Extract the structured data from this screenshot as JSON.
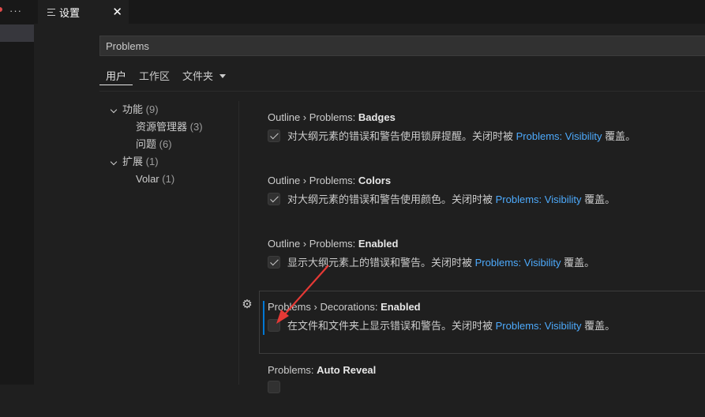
{
  "left_strip": {
    "more_label": "···"
  },
  "tab": {
    "title": "设置",
    "close": "✕"
  },
  "search": {
    "value": "Problems"
  },
  "scope_tabs": [
    {
      "label": "用户",
      "active": true
    },
    {
      "label": "工作区",
      "active": false
    },
    {
      "label": "文件夹",
      "active": false
    }
  ],
  "toc": [
    {
      "label": "功能",
      "count": "(9)",
      "level": 0
    },
    {
      "label": "资源管理器",
      "count": "(3)",
      "level": 1
    },
    {
      "label": "问题",
      "count": "(6)",
      "level": 1
    },
    {
      "label": "扩展",
      "count": "(1)",
      "level": 0
    },
    {
      "label": "Volar",
      "count": "(1)",
      "level": 1
    }
  ],
  "settings": [
    {
      "category": "Outline › Problems: ",
      "name": "Badges",
      "checked": true,
      "desc": "对大纲元素的错误和警告使用锁屏提醒。关闭时被 ",
      "link": "Problems: Visibility",
      "suffix": " 覆盖。"
    },
    {
      "category": "Outline › Problems: ",
      "name": "Colors",
      "checked": true,
      "desc": "对大纲元素的错误和警告使用颜色。关闭时被 ",
      "link": "Problems: Visibility",
      "suffix": " 覆盖。"
    },
    {
      "category": "Outline › Problems: ",
      "name": "Enabled",
      "checked": true,
      "desc": "显示大纲元素上的错误和警告。关闭时被 ",
      "link": "Problems: Visibility",
      "suffix": " 覆盖。"
    },
    {
      "category": "Problems › Decorations: ",
      "name": "Enabled",
      "checked": false,
      "desc": "在文件和文件夹上显示错误和警告。关闭时被 ",
      "link": "Problems: Visibility",
      "suffix": " 覆盖。"
    },
    {
      "category": "Problems: ",
      "name": "Auto Reveal",
      "checked": false,
      "desc": "",
      "link": "",
      "suffix": ""
    }
  ],
  "colors": {
    "accent": "#0078d4",
    "link": "#4daafc",
    "annotation_arrow": "#e53935"
  }
}
